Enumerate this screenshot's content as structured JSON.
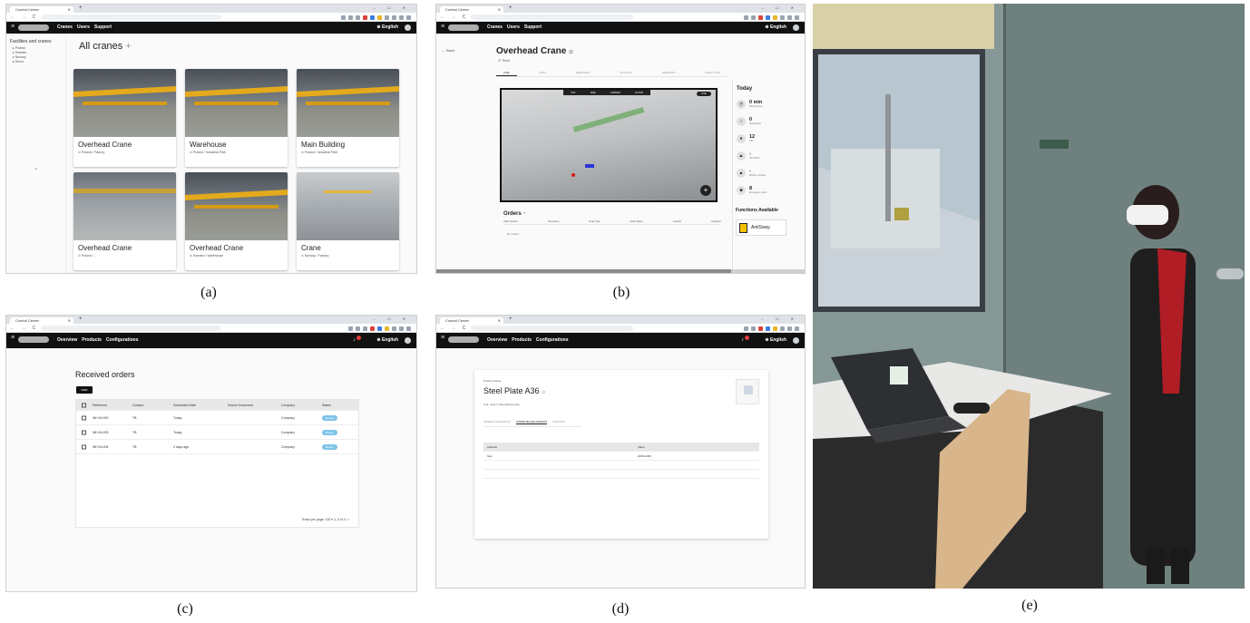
{
  "captions": [
    "(a)",
    "(b)",
    "(c)",
    "(d)",
    "(e)"
  ],
  "browser": {
    "tab_title": "Control Center",
    "window_controls": "–  ☐  ✕"
  },
  "panel_a": {
    "nav": [
      "Cranes",
      "Users",
      "Support"
    ],
    "language": "English",
    "sidebar_title": "Facilities and cranes",
    "sidebar_items": [
      "Poland",
      "Sweden",
      "Norway",
      "Demo"
    ],
    "page_title": "All cranes",
    "add_symbol": "+",
    "cards": [
      {
        "name": "Overhead Crane",
        "location": "Poland / Factory",
        "image": "yellow-crane-hall"
      },
      {
        "name": "Warehouse",
        "location": "Poland / Industrial Park",
        "image": "yellow-crane-hall"
      },
      {
        "name": "Main Building",
        "location": "Poland / Industrial Park",
        "image": "yellow-crane-hall"
      },
      {
        "name": "Overhead Crane",
        "location": "Poland / ...",
        "image": "grey-hall"
      },
      {
        "name": "Overhead Crane",
        "location": "Sweden / Warehouse",
        "image": "yellow-crane-hall"
      },
      {
        "name": "Crane",
        "location": "Norway / Factory",
        "image": "white-hall"
      }
    ]
  },
  "panel_b": {
    "nav": [
      "Cranes",
      "Users",
      "Support"
    ],
    "language": "English",
    "back": "Back",
    "title": "Overhead Crane",
    "subtitle": "Tech",
    "tabs": [
      "LIVE",
      "INFO",
      "SERVICES",
      "ON HOLD",
      "REPORTS",
      "ANALYTICS"
    ],
    "viewport_buttons": [
      "TOP",
      "SIDE",
      "CORNER",
      "FLOOR"
    ],
    "viewport_mode": "LIVE",
    "fab": "+",
    "orders_title": "Orders",
    "orders_columns": [
      "Order Number",
      "Timestamp",
      "Order Type",
      "Order Status",
      "Location",
      "Container"
    ],
    "no_orders": "No orders",
    "today_title": "Today",
    "stats": [
      {
        "value": "0 min",
        "label": "Running time",
        "icon": "clock-icon",
        "glyph": "◷"
      },
      {
        "value": "0",
        "label": "Starts/stops",
        "icon": "crane-icon",
        "glyph": "↕"
      },
      {
        "value": "12",
        "label": "Lifts",
        "icon": "person-icon",
        "glyph": "●"
      },
      {
        "value": "-",
        "label": "Tons lifted",
        "icon": "weight-icon",
        "glyph": "▲"
      },
      {
        "value": "-",
        "label": "Weight overload",
        "icon": "warning-icon",
        "glyph": "▲"
      },
      {
        "value": "8",
        "label": "Emergency stops",
        "icon": "stop-icon",
        "glyph": "■"
      }
    ],
    "functions_title": "Functions Available",
    "function_item": "AntiSway"
  },
  "panel_c": {
    "nav": [
      "Overview",
      "Products",
      "Configurations"
    ],
    "language": "English",
    "title": "Received orders",
    "new_button": "NEW",
    "columns": [
      "Reference",
      "Contact",
      "Scheduled Date",
      "Source Document",
      "Company",
      "Status"
    ],
    "rows": [
      {
        "reference": "WH-IN-002",
        "contact": "TB",
        "date": "Today",
        "source": "",
        "company": "Company",
        "status": "Ready"
      },
      {
        "reference": "WH-IN-003",
        "contact": "TB",
        "date": "Today",
        "source": "",
        "company": "Company",
        "status": "Ready"
      },
      {
        "reference": "WH-IN-004",
        "contact": "TB",
        "date": "2 days ago",
        "source": "",
        "company": "Company",
        "status": "Ready"
      }
    ],
    "footer": "Rows per page: 100 ▾     1–3 of 3   ‹  ›"
  },
  "panel_d": {
    "nav": [
      "Overview",
      "Products",
      "Configurations"
    ],
    "language": "English",
    "label": "Product Name",
    "title": "Steel Plate A36",
    "meta": "Unit: units   ◷ Reordering rules",
    "tabs": [
      "GENERAL INFORMATION",
      "ATTRIBUTES AND VARIANTS",
      "INVENTORY"
    ],
    "columns": [
      "Attribute",
      "Value"
    ],
    "rows": [
      {
        "attribute": "Size",
        "value": "2000x1000"
      }
    ]
  },
  "panel_e": {
    "description_icon": "vr-user-photo"
  }
}
